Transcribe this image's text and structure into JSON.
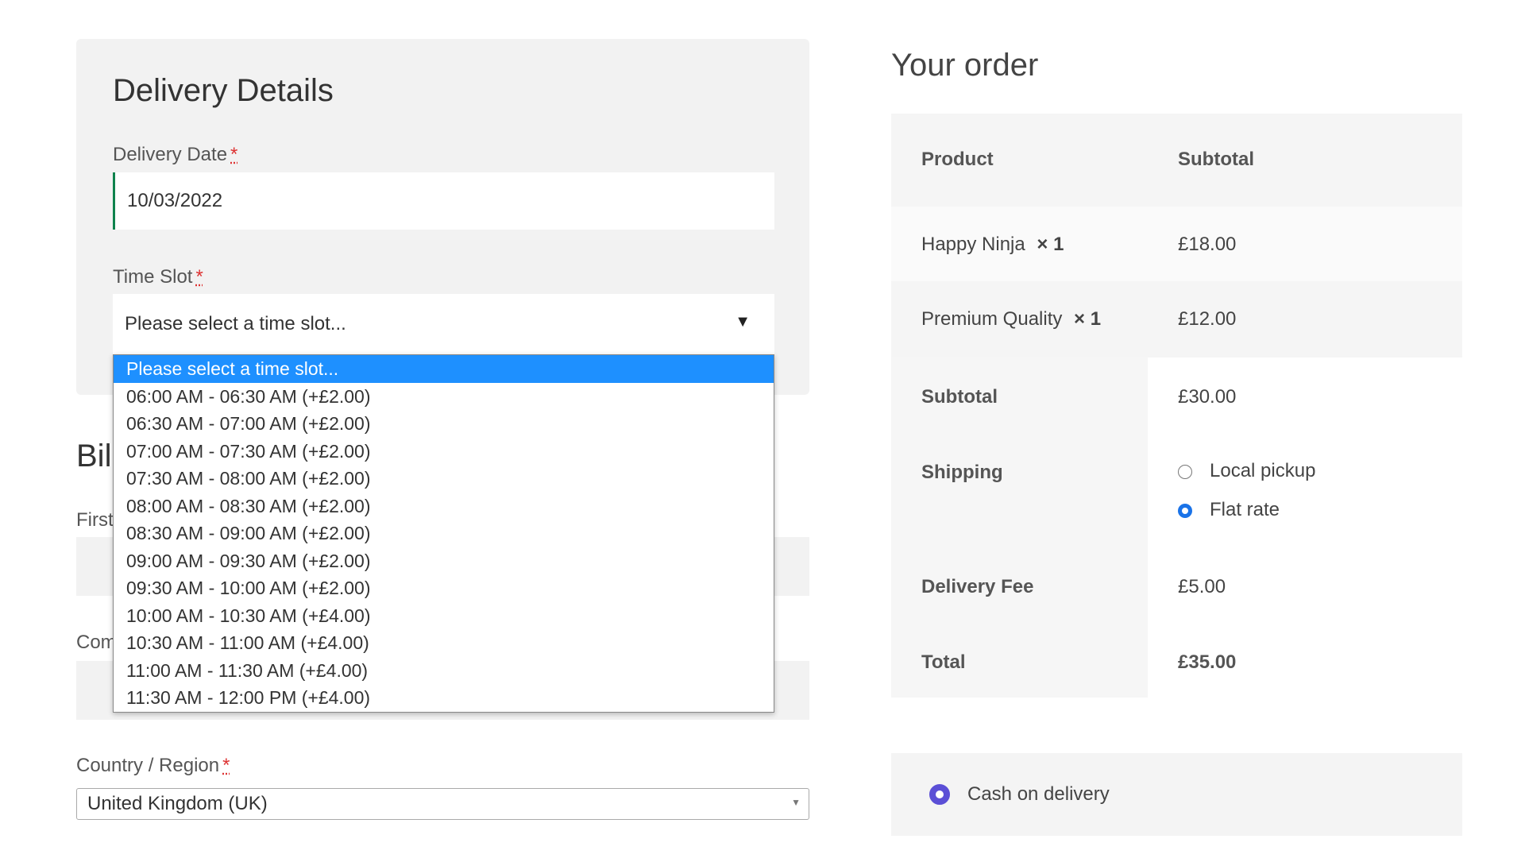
{
  "delivery": {
    "title": "Delivery Details",
    "date_label": "Delivery Date",
    "required": "*",
    "date_value": "10/03/2022",
    "slot_label": "Time Slot",
    "slot_value": "Please select a time slot...",
    "options": [
      "Please select a time slot...",
      "06:00 AM - 06:30 AM (+£2.00)",
      "06:30 AM - 07:00 AM (+£2.00)",
      "07:00 AM - 07:30 AM (+£2.00)",
      "07:30 AM - 08:00 AM (+£2.00)",
      "08:00 AM - 08:30 AM (+£2.00)",
      "08:30 AM - 09:00 AM (+£2.00)",
      "09:00 AM - 09:30 AM (+£2.00)",
      "09:30 AM - 10:00 AM (+£2.00)",
      "10:00 AM - 10:30 AM (+£4.00)",
      "10:30 AM - 11:00 AM (+£4.00)",
      "11:00 AM - 11:30 AM (+£4.00)",
      "11:30 AM - 12:00 PM (+£4.00)"
    ]
  },
  "billing": {
    "title_partial": "Bil",
    "first_partial": "First",
    "company_partial": "Com",
    "country_label": "Country / Region",
    "country_value": "United Kingdom (UK)"
  },
  "order": {
    "title": "Your order",
    "col_product": "Product",
    "col_subtotal": "Subtotal",
    "items": [
      {
        "name": "Happy Ninja",
        "qty": "× 1",
        "price": "£18.00"
      },
      {
        "name": "Premium Quality",
        "qty": "× 1",
        "price": "£12.00"
      }
    ],
    "subtotal_label": "Subtotal",
    "subtotal": "£30.00",
    "shipping_label": "Shipping",
    "shipping_options": [
      "Local pickup",
      "Flat rate"
    ],
    "fee_label": "Delivery Fee",
    "fee": "£5.00",
    "total_label": "Total",
    "total": "£35.00"
  },
  "payment": {
    "method": "Cash on delivery"
  }
}
